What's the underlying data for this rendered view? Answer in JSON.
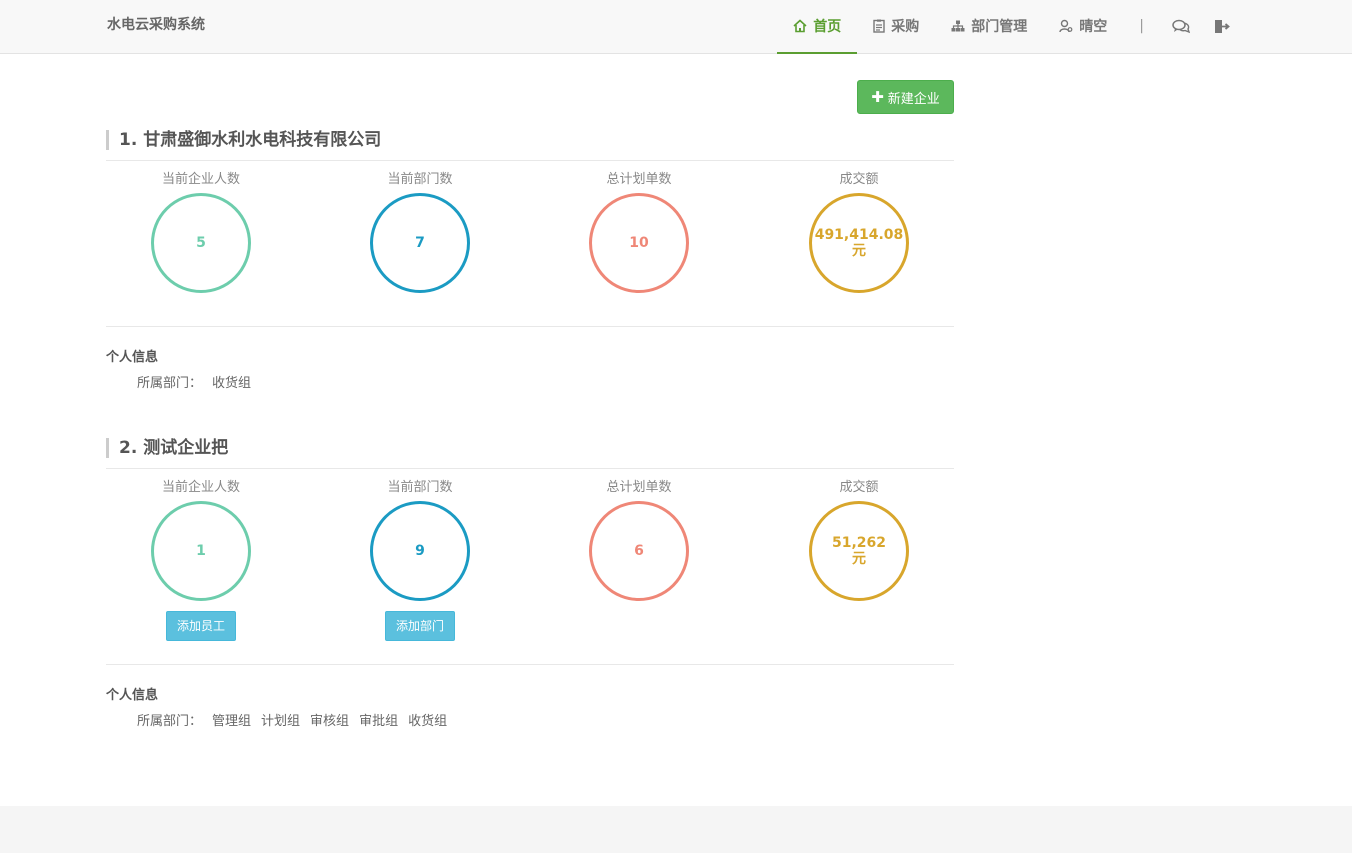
{
  "app": {
    "brand": "水电云采购系统"
  },
  "nav": {
    "items": [
      {
        "label": "首页",
        "icon": "home-icon",
        "active": true
      },
      {
        "label": "采购",
        "icon": "clipboard-icon",
        "active": false
      },
      {
        "label": "部门管理",
        "icon": "sitemap-icon",
        "active": false
      },
      {
        "label": "晴空",
        "icon": "user-icon",
        "active": false
      }
    ],
    "separator": "|",
    "tail_icons": [
      "chat-icon",
      "logout-icon"
    ]
  },
  "actions": {
    "new_company": "新建企业"
  },
  "companies": [
    {
      "title": "1. 甘肃盛御水利水电科技有限公司",
      "stats": [
        {
          "label": "当前企业人数",
          "value": "5",
          "unit": ""
        },
        {
          "label": "当前部门数",
          "value": "7",
          "unit": ""
        },
        {
          "label": "总计划单数",
          "value": "10",
          "unit": ""
        },
        {
          "label": "成交额",
          "value": "491,414.08",
          "unit": "元"
        }
      ],
      "info_title": "个人信息",
      "dept_label": "所属部门：",
      "depts": [
        "收货组"
      ]
    },
    {
      "title": "2. 测试企业把",
      "stats": [
        {
          "label": "当前企业人数",
          "value": "1",
          "unit": ""
        },
        {
          "label": "当前部门数",
          "value": "9",
          "unit": ""
        },
        {
          "label": "总计划单数",
          "value": "6",
          "unit": ""
        },
        {
          "label": "成交额",
          "value": "51,262",
          "unit": "元"
        }
      ],
      "buttons": {
        "add_employee": "添加员工",
        "add_dept": "添加部门"
      },
      "info_title": "个人信息",
      "dept_label": "所属部门：",
      "depts": [
        "管理组",
        "计划组",
        "审核组",
        "审批组",
        "收货组"
      ]
    }
  ],
  "colors": {
    "accent": "#5b9e31",
    "stat_green": "#6dcdac",
    "stat_blue": "#1b9bc3",
    "stat_red": "#ef8777",
    "stat_gold": "#d8a62c",
    "btn_success": "#5cb85c",
    "btn_info": "#5bc0de"
  }
}
